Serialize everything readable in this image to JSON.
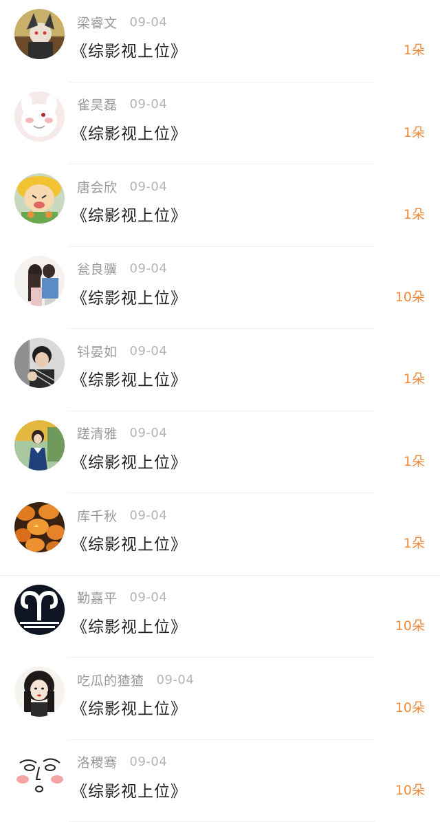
{
  "rows": [
    {
      "name": "梁睿文",
      "date": "09-04",
      "title": "《综影视上位》",
      "gift": "1朵",
      "avatar": "anime-character-avatar"
    },
    {
      "name": "雀昊磊",
      "date": "09-04",
      "title": "《综影视上位》",
      "gift": "1朵",
      "avatar": "white-bunny-avatar"
    },
    {
      "name": "唐会欣",
      "date": "09-04",
      "title": "《综影视上位》",
      "gift": "1朵",
      "avatar": "cartoon-avatar"
    },
    {
      "name": "瓮良骥",
      "date": "09-04",
      "title": "《综影视上位》",
      "gift": "10朵",
      "avatar": "couple-photo-avatar"
    },
    {
      "name": "钭晏如",
      "date": "09-04",
      "title": "《综影视上位》",
      "gift": "1朵",
      "avatar": "boy-photo-avatar"
    },
    {
      "name": "蹉清雅",
      "date": "09-04",
      "title": "《综影视上位》",
      "gift": "1朵",
      "avatar": "girl-photo-avatar"
    },
    {
      "name": "库千秋",
      "date": "09-04",
      "title": "《综影视上位》",
      "gift": "1朵",
      "avatar": "pumpkins-avatar"
    },
    {
      "name": "勤嘉平",
      "date": "09-04",
      "title": "《综影视上位》",
      "gift": "10朵",
      "avatar": "aries-sign-avatar"
    },
    {
      "name": "吃瓜的猹猹",
      "date": "09-04",
      "title": "《综影视上位》",
      "gift": "10朵",
      "avatar": "drawn-girl-avatar"
    },
    {
      "name": "洛稷骞",
      "date": "09-04",
      "title": "《综影视上位》",
      "gift": "10朵",
      "avatar": "doodle-face-avatar"
    }
  ],
  "colors": {
    "name": "#999999",
    "date": "#b4b4b4",
    "title": "#222222",
    "gift": "#ef8a3c",
    "divider": "#f0f0f0"
  }
}
